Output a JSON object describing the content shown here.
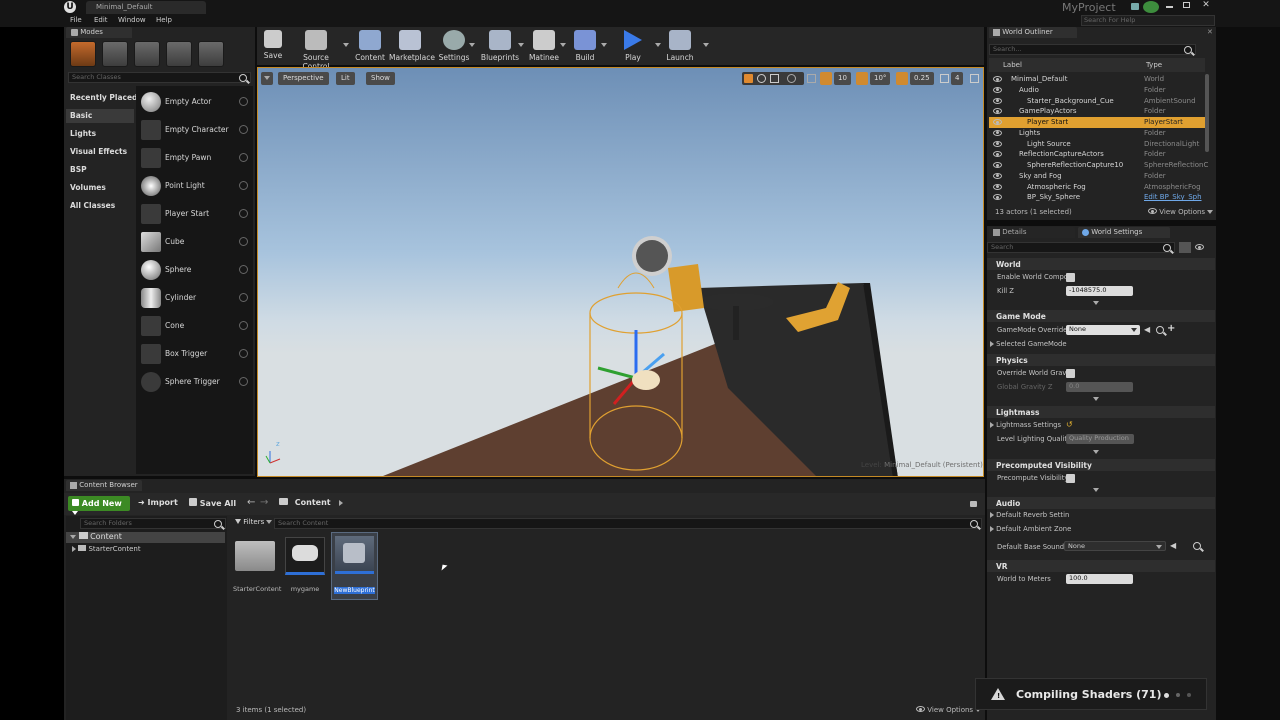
{
  "window": {
    "tab_title": "Minimal_Default",
    "project_name": "MyProject",
    "search_help_placeholder": "Search For Help"
  },
  "menu": [
    "File",
    "Edit",
    "Window",
    "Help"
  ],
  "toolbar": {
    "buttons": [
      "Save",
      "Source Control",
      "Content",
      "Marketplace",
      "Settings",
      "Blueprints",
      "Matinee",
      "Build",
      "Play",
      "Launch"
    ]
  },
  "modes": {
    "tab_label": "Modes",
    "search_placeholder": "Search Classes",
    "categories": [
      "Recently Placed",
      "Basic",
      "Lights",
      "Visual Effects",
      "BSP",
      "Volumes",
      "All Classes"
    ],
    "selected_category": "Basic",
    "items": [
      "Empty Actor",
      "Empty Character",
      "Empty Pawn",
      "Point Light",
      "Player Start",
      "Cube",
      "Sphere",
      "Cylinder",
      "Cone",
      "Box Trigger",
      "Sphere Trigger"
    ]
  },
  "viewport": {
    "perspective_label": "Perspective",
    "lit_label": "Lit",
    "show_label": "Show",
    "grid_snap": "10",
    "rot_snap": "10°",
    "scale_snap": "0.25",
    "cam_speed": "4",
    "level_label": "Level:",
    "level_name": "Minimal_Default (Persistent)"
  },
  "outliner": {
    "tab_label": "World Outliner",
    "search_placeholder": "Search...",
    "col_label": "Label",
    "col_type": "Type",
    "rows": [
      {
        "name": "Minimal_Default",
        "type": "World"
      },
      {
        "name": "Audio",
        "type": "Folder"
      },
      {
        "name": "Starter_Background_Cue",
        "type": "AmbientSound"
      },
      {
        "name": "GamePlayActors",
        "type": "Folder"
      },
      {
        "name": "Player Start",
        "type": "PlayerStart"
      },
      {
        "name": "Lights",
        "type": "Folder"
      },
      {
        "name": "Light Source",
        "type": "DirectionalLight"
      },
      {
        "name": "ReflectionCaptureActors",
        "type": "Folder"
      },
      {
        "name": "SphereReflectionCapture10",
        "type": "SphereReflectionC"
      },
      {
        "name": "Sky and Fog",
        "type": "Folder"
      },
      {
        "name": "Atmospheric Fog",
        "type": "AtmosphericFog"
      },
      {
        "name": "BP_Sky_Sphere",
        "type": "Edit BP_Sky_Sph"
      }
    ],
    "status": "13 actors (1 selected)",
    "view_options": "View Options"
  },
  "details": {
    "tab_details": "Details",
    "tab_world_settings": "World Settings",
    "search_placeholder": "Search",
    "world": {
      "title": "World",
      "enable_world_comp": "Enable World Compos",
      "kill_z_label": "Kill Z",
      "kill_z_value": "-1048575.0"
    },
    "game_mode": {
      "title": "Game Mode",
      "override_label": "GameMode Override",
      "override_value": "None",
      "selected_label": "Selected GameMode"
    },
    "physics": {
      "title": "Physics",
      "override_gravity": "Override World Gravity",
      "global_gravity_label": "Global Gravity Z",
      "global_gravity_value": "0.0"
    },
    "lightmass": {
      "title": "Lightmass",
      "settings_label": "Lightmass Settings",
      "quality_label": "Level Lighting Quality",
      "quality_value": "Quality Production"
    },
    "precomputed": {
      "title": "Precomputed Visibility",
      "label": "Precompute Visibility"
    },
    "audio": {
      "title": "Audio",
      "reverb": "Default Reverb Settin",
      "ambient": "Default Ambient Zone",
      "base_sound_label": "Default Base Sound M",
      "base_sound_value": "None"
    },
    "vr": {
      "title": "VR",
      "wtm_label": "World to Meters",
      "wtm_value": "100.0"
    }
  },
  "content_browser": {
    "tab_label": "Content Browser",
    "add_new": "Add New",
    "import": "Import",
    "save_all": "Save All",
    "path": "Content",
    "search_folders_placeholder": "Search Folders",
    "filters": "Filters",
    "search_content_placeholder": "Search Content",
    "tree": [
      "Content",
      "StarterContent"
    ],
    "assets": [
      "StarterContent",
      "mygame",
      "NewBlueprint"
    ],
    "status": "3 items (1 selected)",
    "view_options": "View Options"
  },
  "notification": {
    "text": "Compiling Shaders (71)"
  }
}
